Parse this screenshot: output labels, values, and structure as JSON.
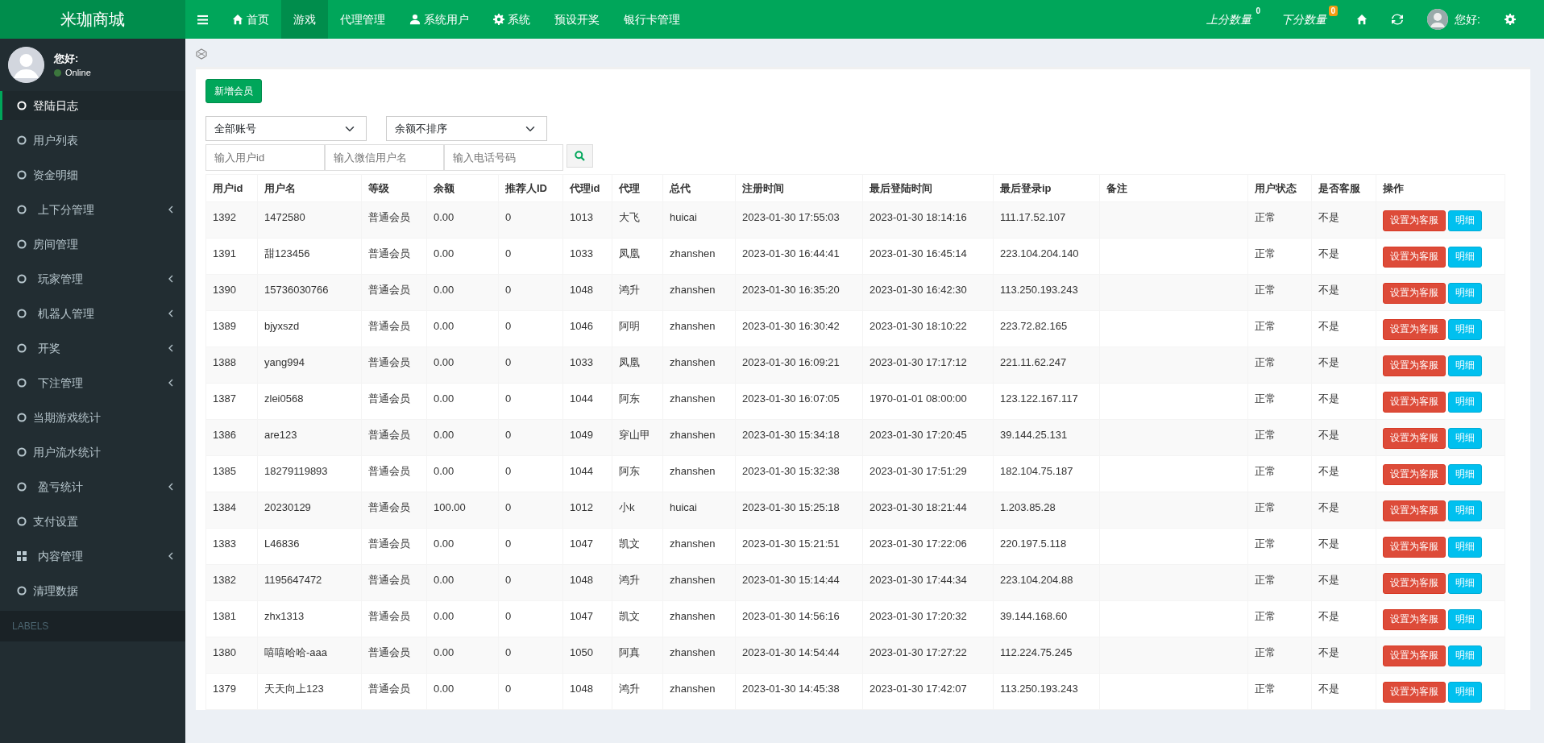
{
  "brand": "米珈商城",
  "top_nav": {
    "items": [
      {
        "label": "首页",
        "kind": "home",
        "selected": false
      },
      {
        "label": "游戏",
        "kind": "plain",
        "selected": true
      },
      {
        "label": "代理管理",
        "kind": "plain",
        "selected": false
      },
      {
        "label": "系统用户",
        "kind": "user",
        "selected": false
      },
      {
        "label": "系统",
        "kind": "gear",
        "selected": false
      },
      {
        "label": "预设开奖",
        "kind": "plain",
        "selected": false
      },
      {
        "label": "银行卡管理",
        "kind": "plain",
        "selected": false
      }
    ],
    "counters": [
      {
        "label": "上分数量",
        "badge": "0",
        "color": "#00a65a"
      },
      {
        "label": "下分数量",
        "badge": "0",
        "color": "#f39c12"
      }
    ],
    "greeting": "您好:"
  },
  "sidebar": {
    "user": {
      "greeting": "您好:",
      "status": "Online"
    },
    "items": [
      {
        "label": "登陆日志",
        "kind": "link",
        "selected": true
      },
      {
        "label": "用户列表",
        "kind": "link",
        "selected": false
      },
      {
        "label": "资金明细",
        "kind": "link",
        "selected": false
      },
      {
        "label": "上下分管理",
        "kind": "submenu",
        "selected": false
      },
      {
        "label": "房间管理",
        "kind": "link",
        "selected": false
      },
      {
        "label": "玩家管理",
        "kind": "submenu",
        "selected": false
      },
      {
        "label": "机器人管理",
        "kind": "submenu",
        "selected": false
      },
      {
        "label": "开奖",
        "kind": "submenu",
        "selected": false
      },
      {
        "label": "下注管理",
        "kind": "submenu",
        "selected": false
      },
      {
        "label": "当期游戏统计",
        "kind": "link",
        "selected": false
      },
      {
        "label": "用户流水统计",
        "kind": "link",
        "selected": false
      },
      {
        "label": "盈亏统计",
        "kind": "submenu",
        "selected": false
      },
      {
        "label": "支付设置",
        "kind": "link",
        "selected": false
      },
      {
        "label": "内容管理",
        "kind": "grid-submenu",
        "selected": false
      },
      {
        "label": "清理数据",
        "kind": "link",
        "selected": false
      }
    ],
    "section_header": "LABELS"
  },
  "content": {
    "add_button": "新增会员",
    "filters": {
      "selects": [
        "全部账号",
        "余额不排序"
      ],
      "inputs": [
        {
          "placeholder": "输入用户id"
        },
        {
          "placeholder": "输入微信用户名"
        },
        {
          "placeholder": "输入电话号码"
        }
      ]
    },
    "table": {
      "columns": [
        "用户id",
        "用户名",
        "等级",
        "余额",
        "推荐人ID",
        "代理id",
        "代理",
        "总代",
        "注册时间",
        "最后登陆时间",
        "最后登录ip",
        "备注",
        "用户状态",
        "是否客服",
        "操作"
      ],
      "rows": [
        {
          "cells": [
            "1392",
            "1472580",
            "普通会员",
            "0.00",
            "0",
            "1013",
            "大飞",
            "huicai",
            "2023-01-30 17:55:03",
            "2023-01-30 18:14:16",
            "111.17.52.107",
            "",
            "正常",
            "不是"
          ],
          "actions": [
            "设置为客服",
            "明细"
          ]
        },
        {
          "cells": [
            "1391",
            "甜123456",
            "普通会员",
            "0.00",
            "0",
            "1033",
            "凤凰",
            "zhanshen",
            "2023-01-30 16:44:41",
            "2023-01-30 16:45:14",
            "223.104.204.140",
            "",
            "正常",
            "不是"
          ],
          "actions": [
            "设置为客服",
            "明细"
          ]
        },
        {
          "cells": [
            "1390",
            "15736030766",
            "普通会员",
            "0.00",
            "0",
            "1048",
            "鸿升",
            "zhanshen",
            "2023-01-30 16:35:20",
            "2023-01-30 16:42:30",
            "113.250.193.243",
            "",
            "正常",
            "不是"
          ],
          "actions": [
            "设置为客服",
            "明细"
          ]
        },
        {
          "cells": [
            "1389",
            "bjyxszd",
            "普通会员",
            "0.00",
            "0",
            "1046",
            "阿明",
            "zhanshen",
            "2023-01-30 16:30:42",
            "2023-01-30 18:10:22",
            "223.72.82.165",
            "",
            "正常",
            "不是"
          ],
          "actions": [
            "设置为客服",
            "明细"
          ]
        },
        {
          "cells": [
            "1388",
            "yang994",
            "普通会员",
            "0.00",
            "0",
            "1033",
            "凤凰",
            "zhanshen",
            "2023-01-30 16:09:21",
            "2023-01-30 17:17:12",
            "221.11.62.247",
            "",
            "正常",
            "不是"
          ],
          "actions": [
            "设置为客服",
            "明细"
          ]
        },
        {
          "cells": [
            "1387",
            "zlei0568",
            "普通会员",
            "0.00",
            "0",
            "1044",
            "阿东",
            "zhanshen",
            "2023-01-30 16:07:05",
            "1970-01-01 08:00:00",
            "123.122.167.117",
            "",
            "正常",
            "不是"
          ],
          "actions": [
            "设置为客服",
            "明细"
          ]
        },
        {
          "cells": [
            "1386",
            "are123",
            "普通会员",
            "0.00",
            "0",
            "1049",
            "穿山甲",
            "zhanshen",
            "2023-01-30 15:34:18",
            "2023-01-30 17:20:45",
            "39.144.25.131",
            "",
            "正常",
            "不是"
          ],
          "actions": [
            "设置为客服",
            "明细"
          ]
        },
        {
          "cells": [
            "1385",
            "18279119893",
            "普通会员",
            "0.00",
            "0",
            "1044",
            "阿东",
            "zhanshen",
            "2023-01-30 15:32:38",
            "2023-01-30 17:51:29",
            "182.104.75.187",
            "",
            "正常",
            "不是"
          ],
          "actions": [
            "设置为客服",
            "明细"
          ]
        },
        {
          "cells": [
            "1384",
            "20230129",
            "普通会员",
            "100.00",
            "0",
            "1012",
            "小k",
            "huicai",
            "2023-01-30 15:25:18",
            "2023-01-30 18:21:44",
            "1.203.85.28",
            "",
            "正常",
            "不是"
          ],
          "actions": [
            "设置为客服",
            "明细"
          ]
        },
        {
          "cells": [
            "1383",
            "L46836",
            "普通会员",
            "0.00",
            "0",
            "1047",
            "凯文",
            "zhanshen",
            "2023-01-30 15:21:51",
            "2023-01-30 17:22:06",
            "220.197.5.118",
            "",
            "正常",
            "不是"
          ],
          "actions": [
            "设置为客服",
            "明细"
          ]
        },
        {
          "cells": [
            "1382",
            "1195647472",
            "普通会员",
            "0.00",
            "0",
            "1048",
            "鸿升",
            "zhanshen",
            "2023-01-30 15:14:44",
            "2023-01-30 17:44:34",
            "223.104.204.88",
            "",
            "正常",
            "不是"
          ],
          "actions": [
            "设置为客服",
            "明细"
          ]
        },
        {
          "cells": [
            "1381",
            "zhx1313",
            "普通会员",
            "0.00",
            "0",
            "1047",
            "凯文",
            "zhanshen",
            "2023-01-30 14:56:16",
            "2023-01-30 17:20:32",
            "39.144.168.60",
            "",
            "正常",
            "不是"
          ],
          "actions": [
            "设置为客服",
            "明细"
          ]
        },
        {
          "cells": [
            "1380",
            "嘻嘻哈哈-aaa",
            "普通会员",
            "0.00",
            "0",
            "1050",
            "阿真",
            "zhanshen",
            "2023-01-30 14:54:44",
            "2023-01-30 17:27:22",
            "112.224.75.245",
            "",
            "正常",
            "不是"
          ],
          "actions": [
            "设置为客服",
            "明细"
          ]
        },
        {
          "cells": [
            "1379",
            "天天向上123",
            "普通会员",
            "0.00",
            "0",
            "1048",
            "鸿升",
            "zhanshen",
            "2023-01-30 14:45:38",
            "2023-01-30 17:42:07",
            "113.250.193.243",
            "",
            "正常",
            "不是"
          ],
          "actions": [
            "设置为客服",
            "明细"
          ]
        }
      ]
    }
  }
}
